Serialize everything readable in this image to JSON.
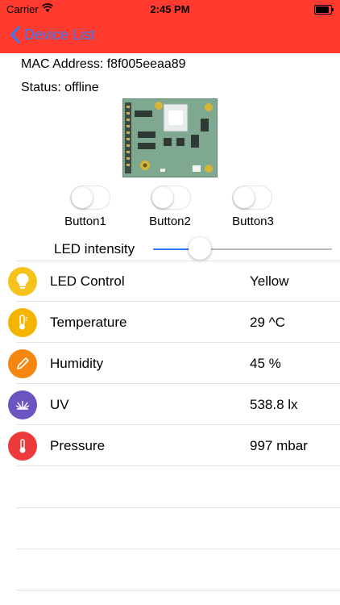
{
  "status_bar": {
    "carrier": "Carrier",
    "time": "2:45 PM"
  },
  "nav": {
    "back_label": "Device List"
  },
  "device": {
    "mac_label": "MAC Address: f8f005eeaa89",
    "status_label": "Status: offline"
  },
  "buttons": [
    {
      "label": "Button1",
      "on": false
    },
    {
      "label": "Button2",
      "on": false
    },
    {
      "label": "Button3",
      "on": false
    }
  ],
  "led_intensity": {
    "label": "LED intensity",
    "value": 0.26
  },
  "rows": [
    {
      "name": "LED Control",
      "value": "Yellow",
      "icon": "bulb-icon",
      "color": "#f7c21c"
    },
    {
      "name": "Temperature",
      "value": "29 ^C",
      "icon": "thermometer-icon",
      "color": "#f5b400"
    },
    {
      "name": "Humidity",
      "value": "45 %",
      "icon": "pencil-icon",
      "color": "#f5860f"
    },
    {
      "name": "UV",
      "value": "538.8 lx",
      "icon": "sun-rays-icon",
      "color": "#6c55c0"
    },
    {
      "name": "Pressure",
      "value": "997 mbar",
      "icon": "gauge-icon",
      "color": "#ee3a3a"
    }
  ],
  "colors": {
    "header": "#ff3b30",
    "accent": "#3478f6"
  }
}
